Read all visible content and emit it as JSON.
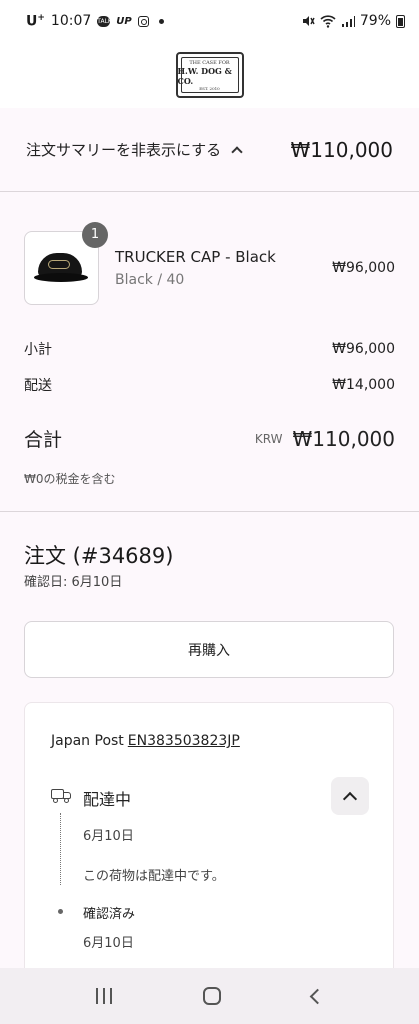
{
  "status_bar": {
    "carrier": "U",
    "carrier_sup": "+",
    "time": "10:07",
    "battery": "79%",
    "icons": [
      "chat-icon",
      "up-icon",
      "instagram-icon",
      "dot-icon",
      "mute-icon",
      "wifi-icon",
      "signal-icon",
      "battery-icon"
    ]
  },
  "header": {
    "logo_line1": "THE CASE FOR",
    "logo_line2": "H.W. DOG & CO.",
    "logo_line3": "EST. 2010"
  },
  "summary": {
    "toggle_label": "注文サマリーを非表示にする",
    "total": "₩110,000"
  },
  "item": {
    "quantity": "1",
    "name": "TRUCKER CAP - Black",
    "variant": "Black / 40",
    "price": "₩96,000"
  },
  "totals": {
    "subtotal_label": "小計",
    "subtotal_value": "₩96,000",
    "shipping_label": "配送",
    "shipping_value": "₩14,000",
    "total_label": "合計",
    "currency": "KRW",
    "total_value": "₩110,000",
    "tax_note": "₩0の税金を含む"
  },
  "order": {
    "title": "注文 (#34689)",
    "confirmed_date": "確認日: 6月10日",
    "rebuy_label": "再購入"
  },
  "tracking": {
    "carrier": "Japan Post",
    "tracking_number": "EN383503823JP",
    "status": "配達中",
    "event1_date": "6月10日",
    "event1_text": "この荷物は配達中です。",
    "event2_title": "確認済み",
    "event2_date": "6月10日"
  }
}
